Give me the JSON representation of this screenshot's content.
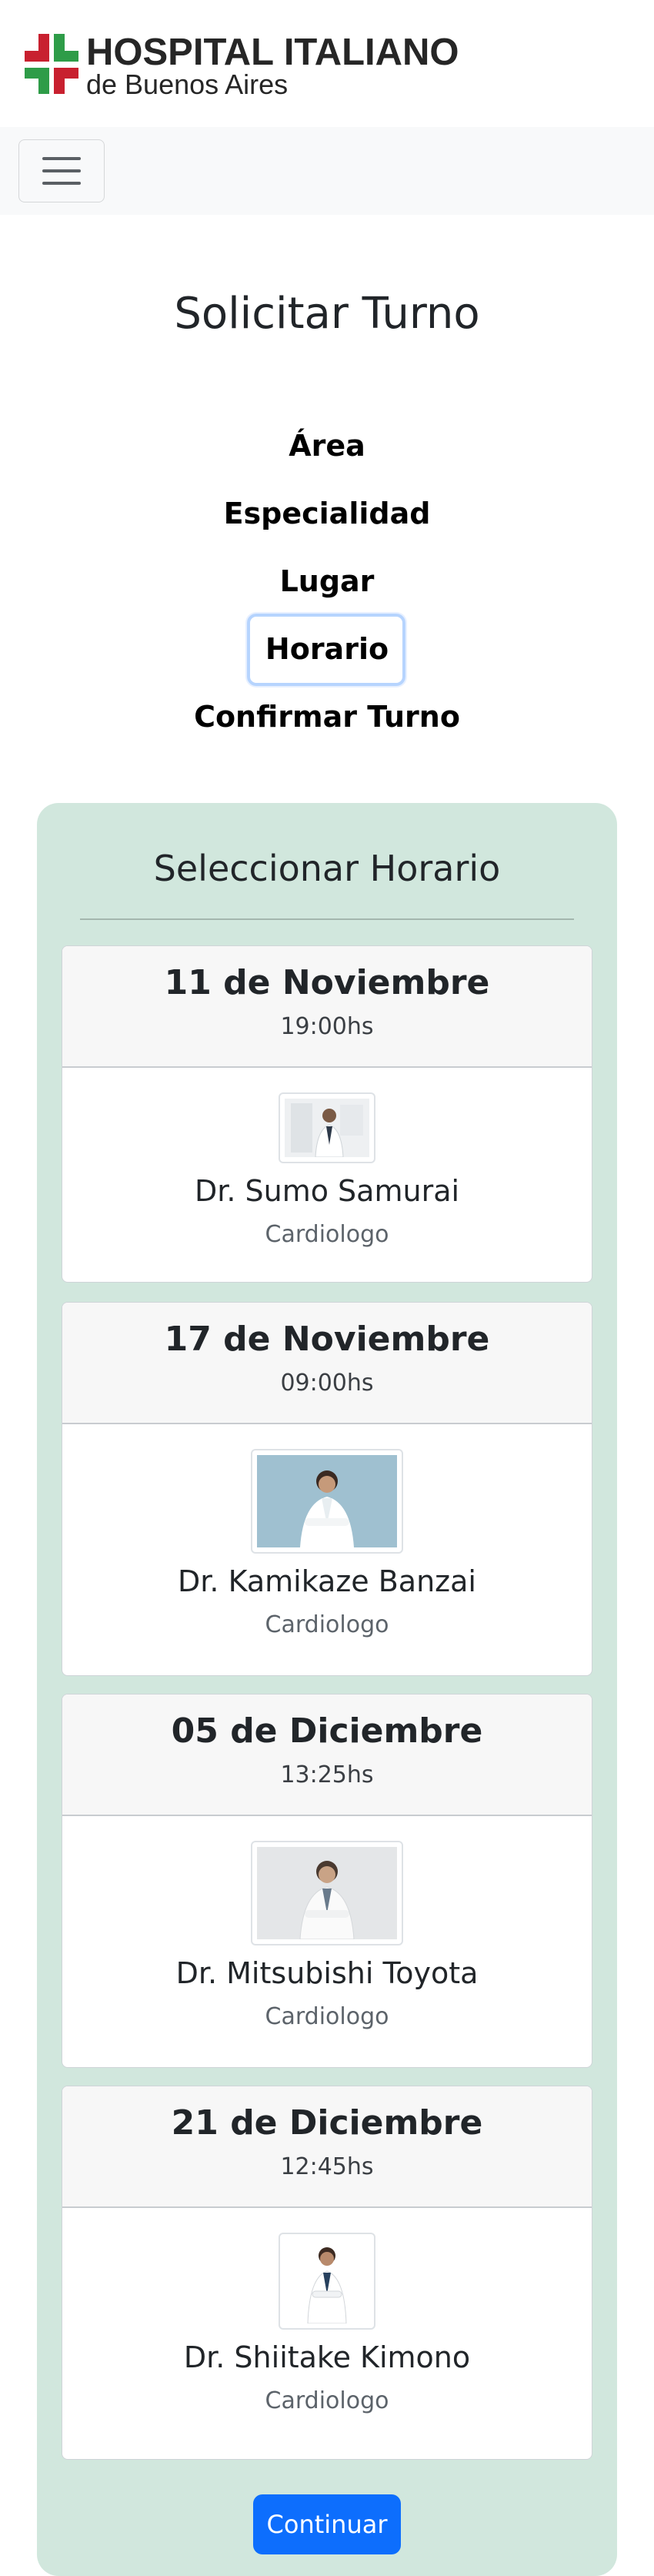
{
  "brand": {
    "line1": "HOSPITAL ITALIANO",
    "line2": "de Buenos Aires",
    "cross_red": "#c8202f",
    "cross_green": "#2e9c48"
  },
  "navbar": {
    "toggler_icon": "hamburger-icon"
  },
  "page": {
    "title": "Solicitar Turno"
  },
  "steps": [
    {
      "label": "Área",
      "active": false
    },
    {
      "label": "Especialidad",
      "active": false
    },
    {
      "label": "Lugar",
      "active": false
    },
    {
      "label": "Horario",
      "active": true
    },
    {
      "label": "Confirmar Turno",
      "active": false
    }
  ],
  "panel": {
    "title": "Seleccionar Horario",
    "background": "#d1e7dd",
    "appointments": [
      {
        "date": "11 de Noviembre",
        "time": "19:00hs",
        "doctor": "Dr. Sumo Samurai",
        "specialty": "Cardiologo"
      },
      {
        "date": "17 de Noviembre",
        "time": "09:00hs",
        "doctor": "Dr. Kamikaze Banzai",
        "specialty": "Cardiologo"
      },
      {
        "date": "05 de Diciembre",
        "time": "13:25hs",
        "doctor": "Dr. Mitsubishi Toyota",
        "specialty": "Cardiologo"
      },
      {
        "date": "21 de Diciembre",
        "time": "12:45hs",
        "doctor": "Dr. Shiitake Kimono",
        "specialty": "Cardiologo"
      }
    ],
    "continue_label": "Continuar",
    "accent": "#0d6efd"
  }
}
